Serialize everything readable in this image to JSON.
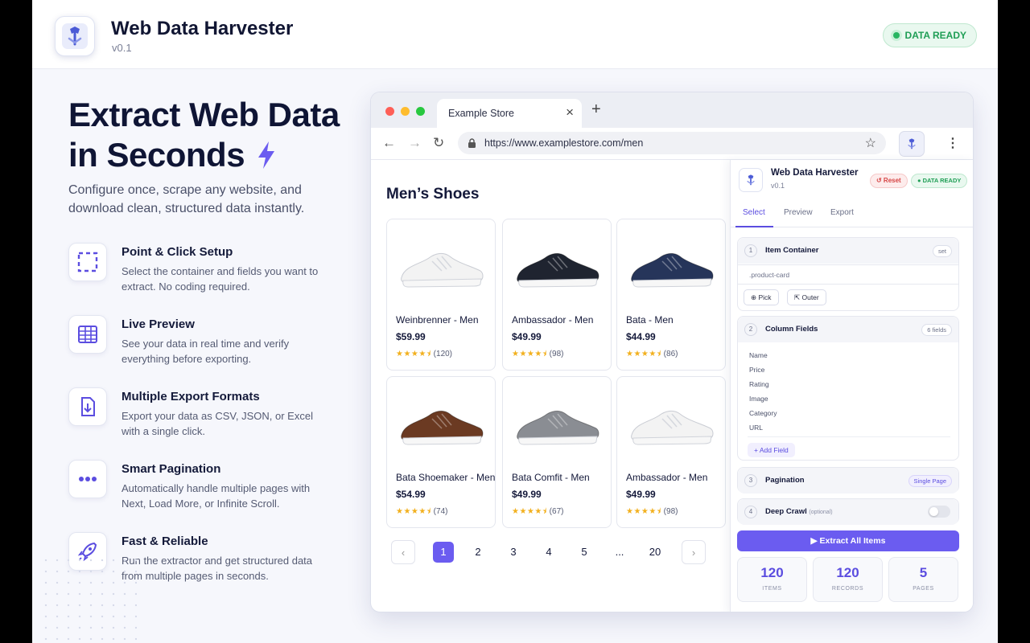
{
  "app": {
    "title": "Web Data Harvester",
    "version": "v0.1",
    "status_badge": "DATA READY"
  },
  "hero": {
    "title_line1": "Extract Web Data",
    "title_line2": "in Seconds",
    "subtitle": "Configure once, scrape any website, and download clean, structured data instantly."
  },
  "features": [
    {
      "icon": "selection-icon",
      "title": "Point & Click Setup",
      "desc": "Select the container and fields you want to extract. No coding required."
    },
    {
      "icon": "table-icon",
      "title": "Live Preview",
      "desc": "See your data in real time and verify everything before exporting."
    },
    {
      "icon": "download-file-icon",
      "title": "Multiple Export Formats",
      "desc": "Export your data as CSV, JSON, or Excel with a single click."
    },
    {
      "icon": "more-dots-icon",
      "title": "Smart Pagination",
      "desc": "Automatically handle multiple pages with Next, Load More, or Infinite Scroll."
    },
    {
      "icon": "rocket-icon",
      "title": "Fast & Reliable",
      "desc": "Run the extractor and get structured data from multiple pages in seconds."
    }
  ],
  "browser": {
    "tab_title": "Example Store",
    "url": "https://www.examplestore.com/men"
  },
  "store": {
    "heading": "Men’s Shoes",
    "products": [
      {
        "name": "Weinbrenner - Men",
        "price": "$59.99",
        "stars": "★★★★⯨",
        "count": "(120)",
        "color": "white"
      },
      {
        "name": "Ambassador - Men",
        "price": "$49.99",
        "stars": "★★★★⯨",
        "count": "(98)",
        "color": "black"
      },
      {
        "name": "Bata - Men",
        "price": "$44.99",
        "stars": "★★★★⯨",
        "count": "(86)",
        "color": "navy"
      },
      {
        "name": "Bata Shoemaker - Men",
        "price": "$54.99",
        "stars": "★★★★⯨",
        "count": "(74)",
        "color": "brown"
      },
      {
        "name": "Bata Comfit - Men",
        "price": "$49.99",
        "stars": "★★★★⯨",
        "count": "(67)",
        "color": "grey"
      },
      {
        "name": "Ambassador - Men",
        "price": "$49.99",
        "stars": "★★★★⯨",
        "count": "(98)",
        "color": "white"
      }
    ],
    "pagination": {
      "prev": "‹",
      "pages": [
        "1",
        "2",
        "3",
        "4",
        "5",
        "...",
        "20"
      ],
      "next": "›",
      "active": "1"
    }
  },
  "panel": {
    "title": "Web Data Harvester",
    "version": "v0.1",
    "reset_label": "↺ Reset",
    "ready_label": "● DATA READY",
    "tabs": [
      "Select",
      "Preview",
      "Export"
    ],
    "sections": {
      "container": {
        "num": "1",
        "title": "Item Container",
        "tag": "set",
        "selector": ".product-card",
        "pick": "⊕ Pick",
        "outer": "⇱ Outer"
      },
      "fields": {
        "num": "2",
        "title": "Column Fields",
        "tag": "6 fields",
        "items": [
          "Name",
          "Price",
          "Rating",
          "Image",
          "Category",
          "URL"
        ],
        "add": "+ Add Field"
      },
      "pagination": {
        "num": "3",
        "title": "Pagination",
        "tag": "Single Page"
      },
      "deep": {
        "num": "4",
        "title": "Deep Crawl",
        "optional": "(optional)",
        "enabled": false
      }
    },
    "extract_label": "▶ Extract All Items",
    "stats": [
      {
        "value": "120",
        "label": "ITEMS"
      },
      {
        "value": "120",
        "label": "RECORDS"
      },
      {
        "value": "5",
        "label": "PAGES"
      }
    ]
  },
  "colors": {
    "accent": "#6b5cf0",
    "success": "#27b561",
    "danger": "#d64545",
    "star": "#f2b01e"
  }
}
